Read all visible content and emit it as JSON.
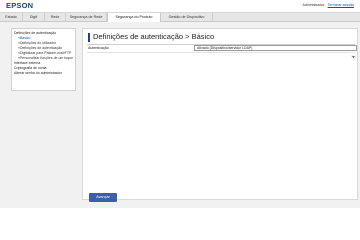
{
  "header": {
    "logo_text": "EPSON",
    "admin_label": "Administrador",
    "logout_label": "Terminar sessão"
  },
  "tabs": [
    {
      "label": "Estado",
      "active": false
    },
    {
      "label": "Digit",
      "active": false
    },
    {
      "label": "Rede",
      "active": false
    },
    {
      "label": "Segurança de Rede",
      "active": false
    },
    {
      "label": "Segurança do Produto",
      "active": true
    },
    {
      "label": "Gestão de Dispositivo",
      "active": false
    }
  ],
  "sidebar": {
    "items": [
      {
        "label": "Definições de autenticação"
      },
      {
        "label": "»Básico"
      },
      {
        "label": "»Definições do utilizador"
      },
      {
        "label": "»Definições de autenticação"
      },
      {
        "label": "»Digitalizar para Pasta/e-mail/FTP"
      },
      {
        "label": "»Personalizar funções de um toque"
      },
      {
        "label": "Interface externa"
      },
      {
        "label": "Criptografia de conta"
      },
      {
        "label": "Alterar senha do administrador"
      }
    ]
  },
  "main": {
    "title": "Definições de autenticação > Básico",
    "form": {
      "auth_label": "Autenticação",
      "auth_value": "Ativado (Dispositivo/servidor LDAP)"
    },
    "submit_label": "Avançar"
  },
  "colors": {
    "brand": "#1c3f94",
    "button": "#3d5fa5",
    "link": "#1a4fa0"
  }
}
